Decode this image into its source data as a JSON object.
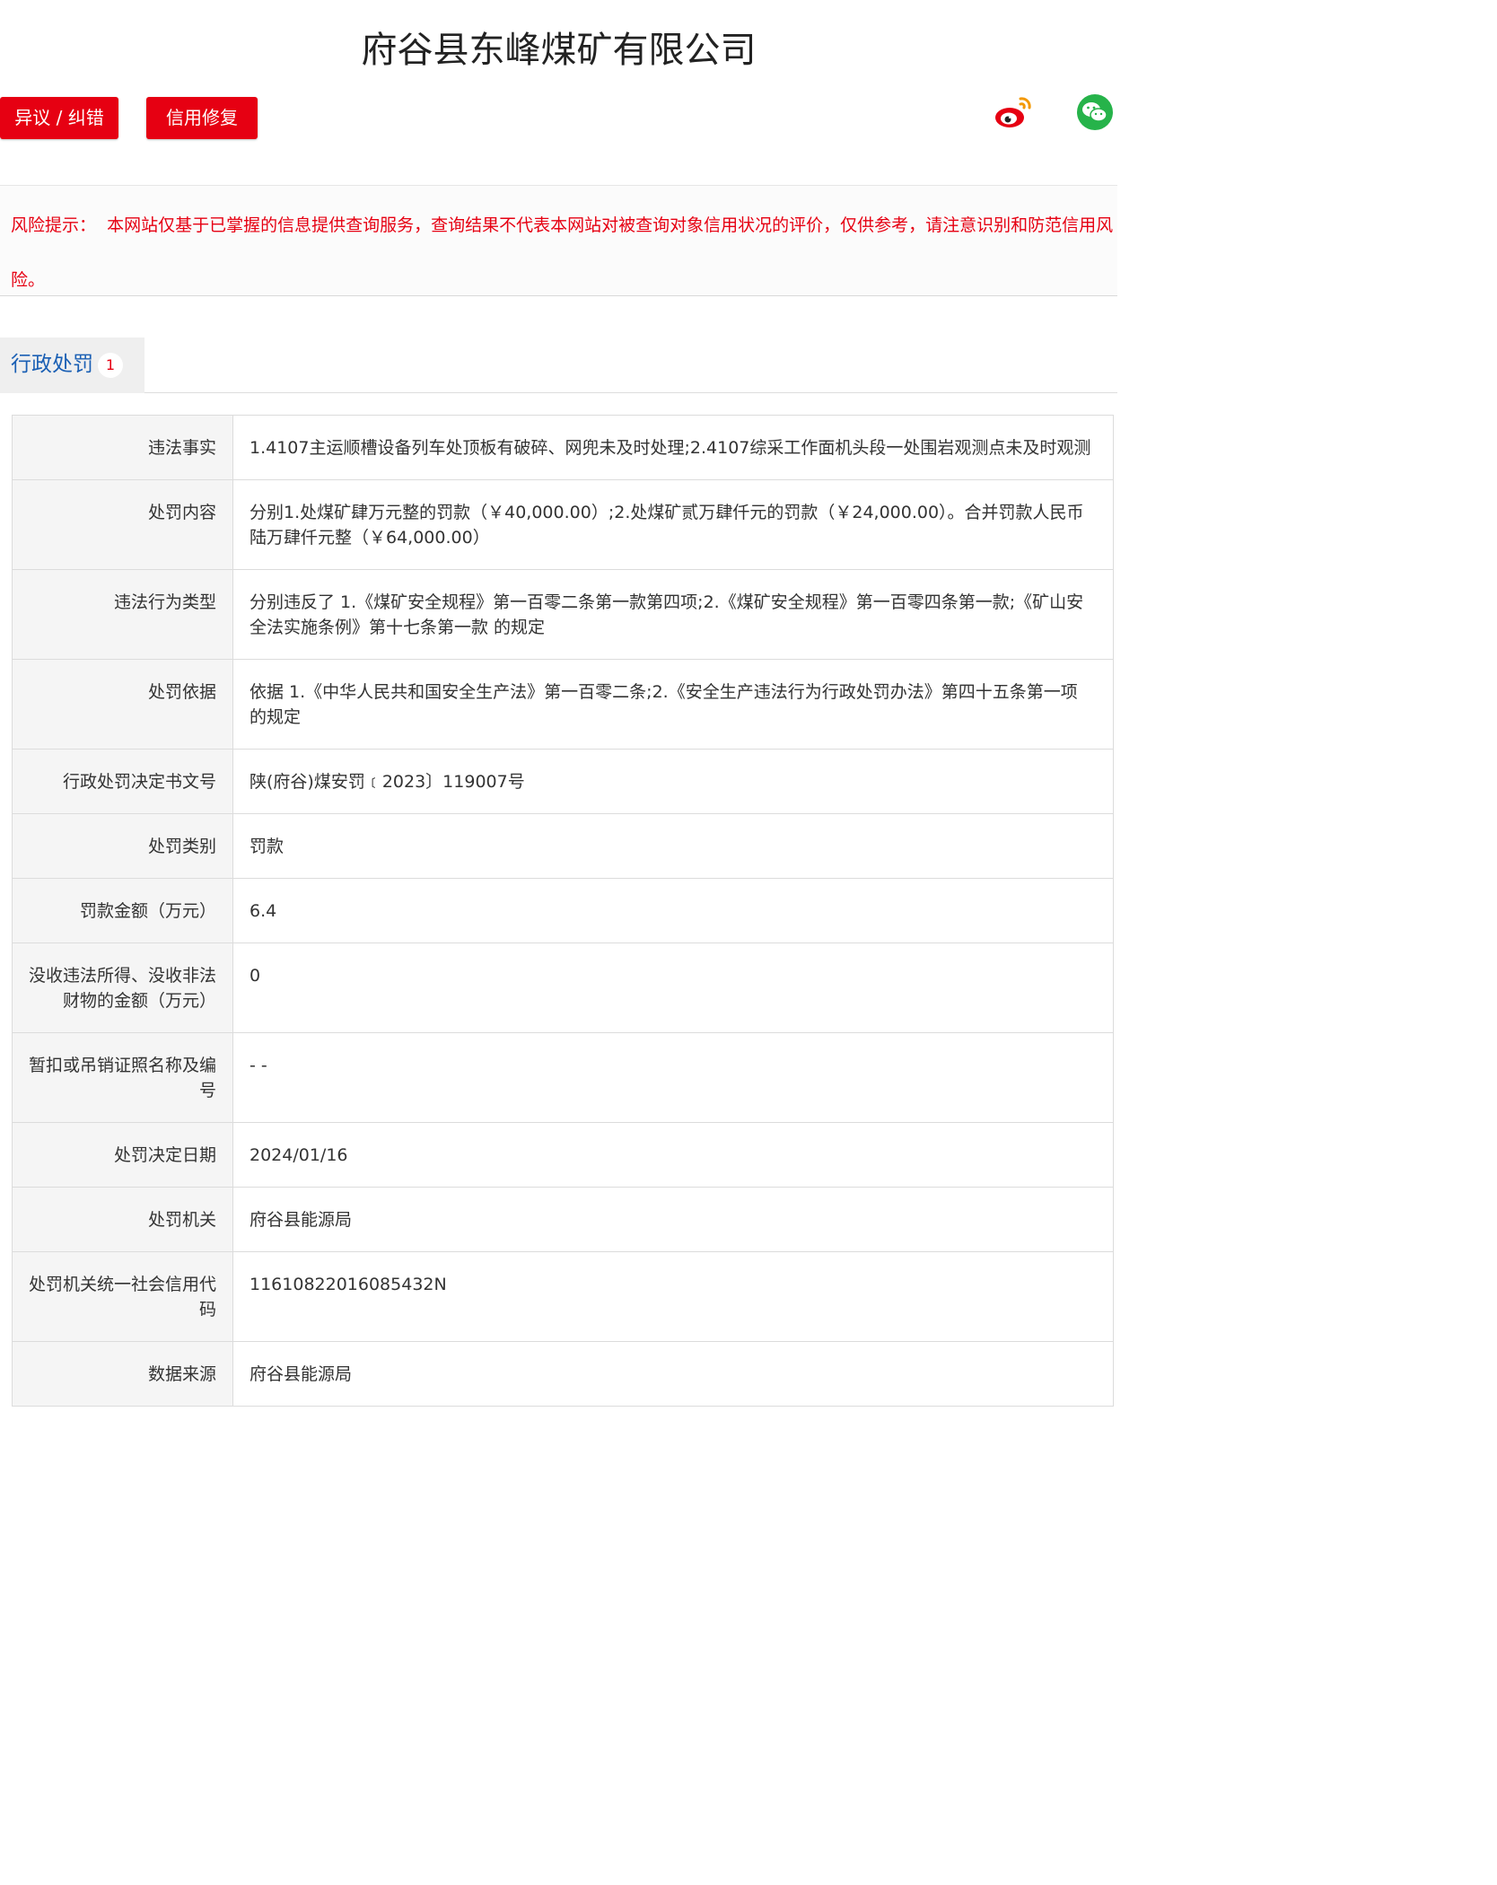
{
  "header": {
    "company_name": "府谷县东峰煤矿有限公司"
  },
  "actions": {
    "objection_label": "异议 / 纠错",
    "repair_label": "信用修复"
  },
  "share": {
    "weibo_icon": "weibo-icon",
    "wechat_icon": "wechat-icon"
  },
  "risk_notice": {
    "prefix": "风险提示：",
    "text": "本网站仅基于已掌握的信息提供查询服务，查询结果不代表本网站对被查询对象信用状况的评价，仅供参考，请注意识别和防范信用风险。"
  },
  "tabs": [
    {
      "label": "行政处罚",
      "count": "1"
    }
  ],
  "colors": {
    "accent_red": "#e60012",
    "tab_blue": "#1a5fb4"
  },
  "records": [
    {
      "label": "违法事实",
      "value": "1.4107主运顺槽设备列车处顶板有破碎、网兜未及时处理;2.4107综采工作面机头段一处围岩观测点未及时观测"
    },
    {
      "label": "处罚内容",
      "value": "分别1.处煤矿肆万元整的罚款（￥40,000.00）;2.处煤矿贰万肆仟元的罚款（￥24,000.00）。合并罚款人民币陆万肆仟元整（￥64,000.00）"
    },
    {
      "label": "违法行为类型",
      "value": "分别违反了 1.《煤矿安全规程》第一百零二条第一款第四项;2.《煤矿安全规程》第一百零四条第一款;《矿山安全法实施条例》第十七条第一款 的规定"
    },
    {
      "label": "处罚依据",
      "value": "依据 1.《中华人民共和国安全生产法》第一百零二条;2.《安全生产违法行为行政处罚办法》第四十五条第一项 的规定"
    },
    {
      "label": "行政处罚决定书文号",
      "value": "陕(府谷)煤安罚﹝2023〕119007号"
    },
    {
      "label": "处罚类别",
      "value": "罚款"
    },
    {
      "label": "罚款金额（万元）",
      "value": "6.4"
    },
    {
      "label": "没收违法所得、没收非法财物的金额（万元）",
      "value": "0"
    },
    {
      "label": "暂扣或吊销证照名称及编号",
      "value": "- -"
    },
    {
      "label": "处罚决定日期",
      "value": "2024/01/16"
    },
    {
      "label": "处罚机关",
      "value": "府谷县能源局"
    },
    {
      "label": "处罚机关统一社会信用代码",
      "value": "11610822016085432N"
    },
    {
      "label": "数据来源",
      "value": "府谷县能源局"
    }
  ]
}
